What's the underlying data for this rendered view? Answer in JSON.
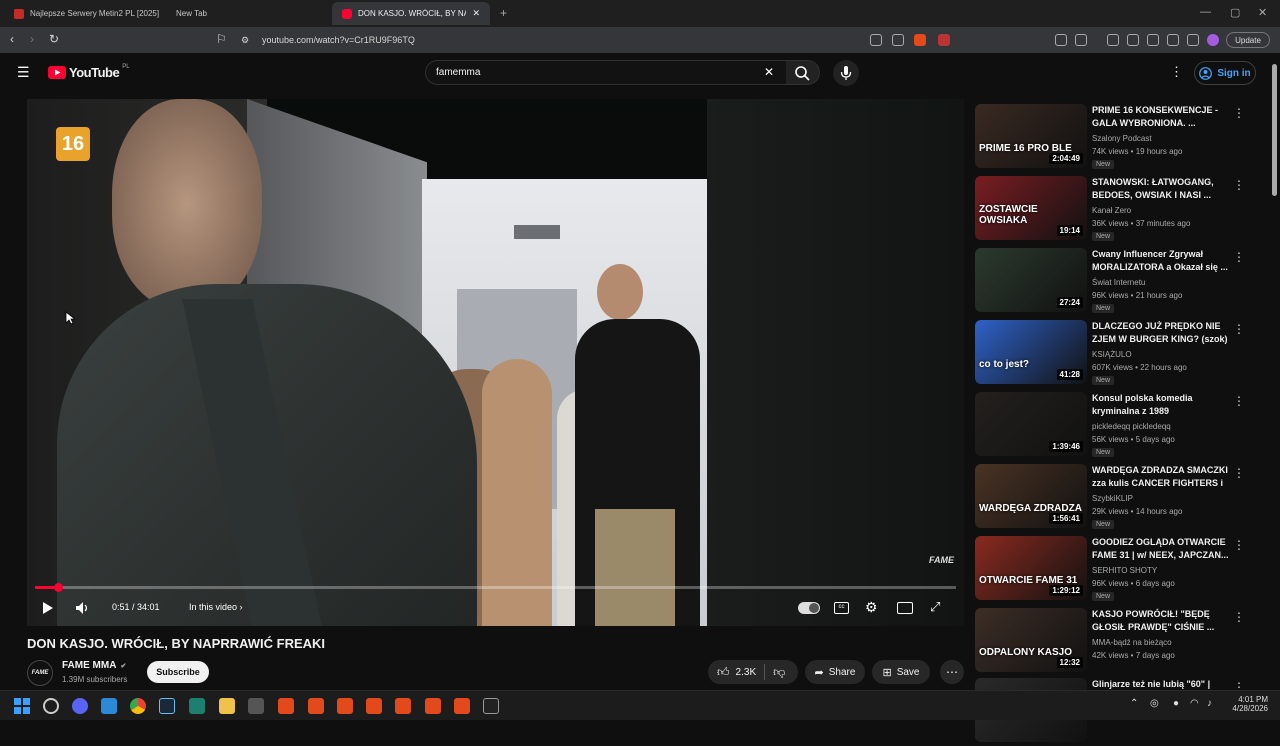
{
  "browser": {
    "tabs": [
      {
        "label": "Najlepsze Serwery Metin2 PL [2025]"
      },
      {
        "label": "New Tab"
      },
      {
        "label": "DON KASJO. WRÓCIŁ, BY NAPR"
      }
    ],
    "url": "youtube.com/watch?v=Cr1RU9F96TQ",
    "update_label": "Update"
  },
  "youtube": {
    "logo_text": "YouTube",
    "region": "PL",
    "search_value": "famemma",
    "signin_label": "Sign in"
  },
  "player": {
    "age_badge": "16",
    "watermark": "FAME",
    "time": "0:51 / 34:01",
    "chapters_label": "In this video",
    "progress_fraction": 0.025
  },
  "video": {
    "title": "DON KASJO. WRÓCIŁ, BY NAPRRAWIĆ FREAKI",
    "channel": "FAME MMA",
    "subscribers": "1.39M subscribers",
    "subscribe_label": "Subscribe",
    "likes": "2.3K",
    "share_label": "Share",
    "save_label": "Save"
  },
  "recommendations": [
    {
      "title": "PRIME 16 KONSEKWENCJE - GALA WYBRONIONA. ...",
      "channel": "Szalony Podcast",
      "meta": "74K views • 19 hours ago",
      "badge": "New",
      "duration": "2:04:49",
      "thumb_text": "PRIME 16 PRO BLE",
      "color": "#3a2a22"
    },
    {
      "title": "STANOWSKI: ŁATWOGANG, BEDOES, OWSIAK I NASI ...",
      "channel": "Kanał Zero",
      "meta": "36K views • 37 minutes ago",
      "badge": "New",
      "duration": "19:14",
      "thumb_text": "ZOSTAWCIE OWSIAKA",
      "color": "#7a1d22"
    },
    {
      "title": "Cwany Influencer Zgrywał MORALIZATORA a Okazał się ...",
      "channel": "Świat Internetu",
      "meta": "96K views • 21 hours ago",
      "badge": "New",
      "duration": "27:24",
      "thumb_text": "",
      "color": "#2b3a2e"
    },
    {
      "title": "DLACZEGO JUŻ PRĘDKO NIE ZJEM W BURGER KING? (szok)",
      "channel": "KSIĄŻULO",
      "meta": "607K views • 22 hours ago",
      "badge": "New",
      "duration": "41:28",
      "thumb_text": "co to jest?",
      "color": "#2f62c9"
    },
    {
      "title": "Konsul  polska komedia kryminalna z 1989",
      "channel": "pickledeqq pickledeqq",
      "meta": "56K views • 5 days ago",
      "badge": "New",
      "duration": "1:39:46",
      "thumb_text": "",
      "color": "#23201d"
    },
    {
      "title": "WARDĘGA ZDRADZA SMACZKI zza kulis CANCER FIGHTERS i ...",
      "channel": "SzybkiKLIP",
      "meta": "29K views • 14 hours ago",
      "badge": "New",
      "duration": "1:56:41",
      "thumb_text": "WARDĘGA ZDRADZA",
      "color": "#4a3324"
    },
    {
      "title": "GOODIEZ OGLĄDA OTWARCIE FAME 31 | w/ NEEX, JAPCZAN...",
      "channel": "SERHITO SHOTY",
      "meta": "96K views • 6 days ago",
      "badge": "New",
      "duration": "1:29:12",
      "thumb_text": "OTWARCIE FAME 31",
      "color": "#8a2a20"
    },
    {
      "title": "KASJO POWRÓCIŁ! \"BĘDĘ GŁOSIŁ PRAWDĘ\" CIŚNIE ...",
      "channel": "MMA-bądź na bieżąco",
      "meta": "42K views • 7 days ago",
      "badge": "",
      "duration": "12:32",
      "thumb_text": "ODPALONY KASJO",
      "color": "#3d2e26"
    },
    {
      "title": "Glinjarze też nie lubią \"60\" |",
      "channel": "",
      "meta": "",
      "badge": "",
      "duration": "",
      "thumb_text": "",
      "color": "#2a2a2a"
    }
  ],
  "taskbar": {
    "time": "4:01 PM",
    "date": "4/28/2026"
  },
  "colors": {
    "accent": "#3ea6ff",
    "progress": "#ff0033",
    "youtube_red": "#ff0033"
  }
}
